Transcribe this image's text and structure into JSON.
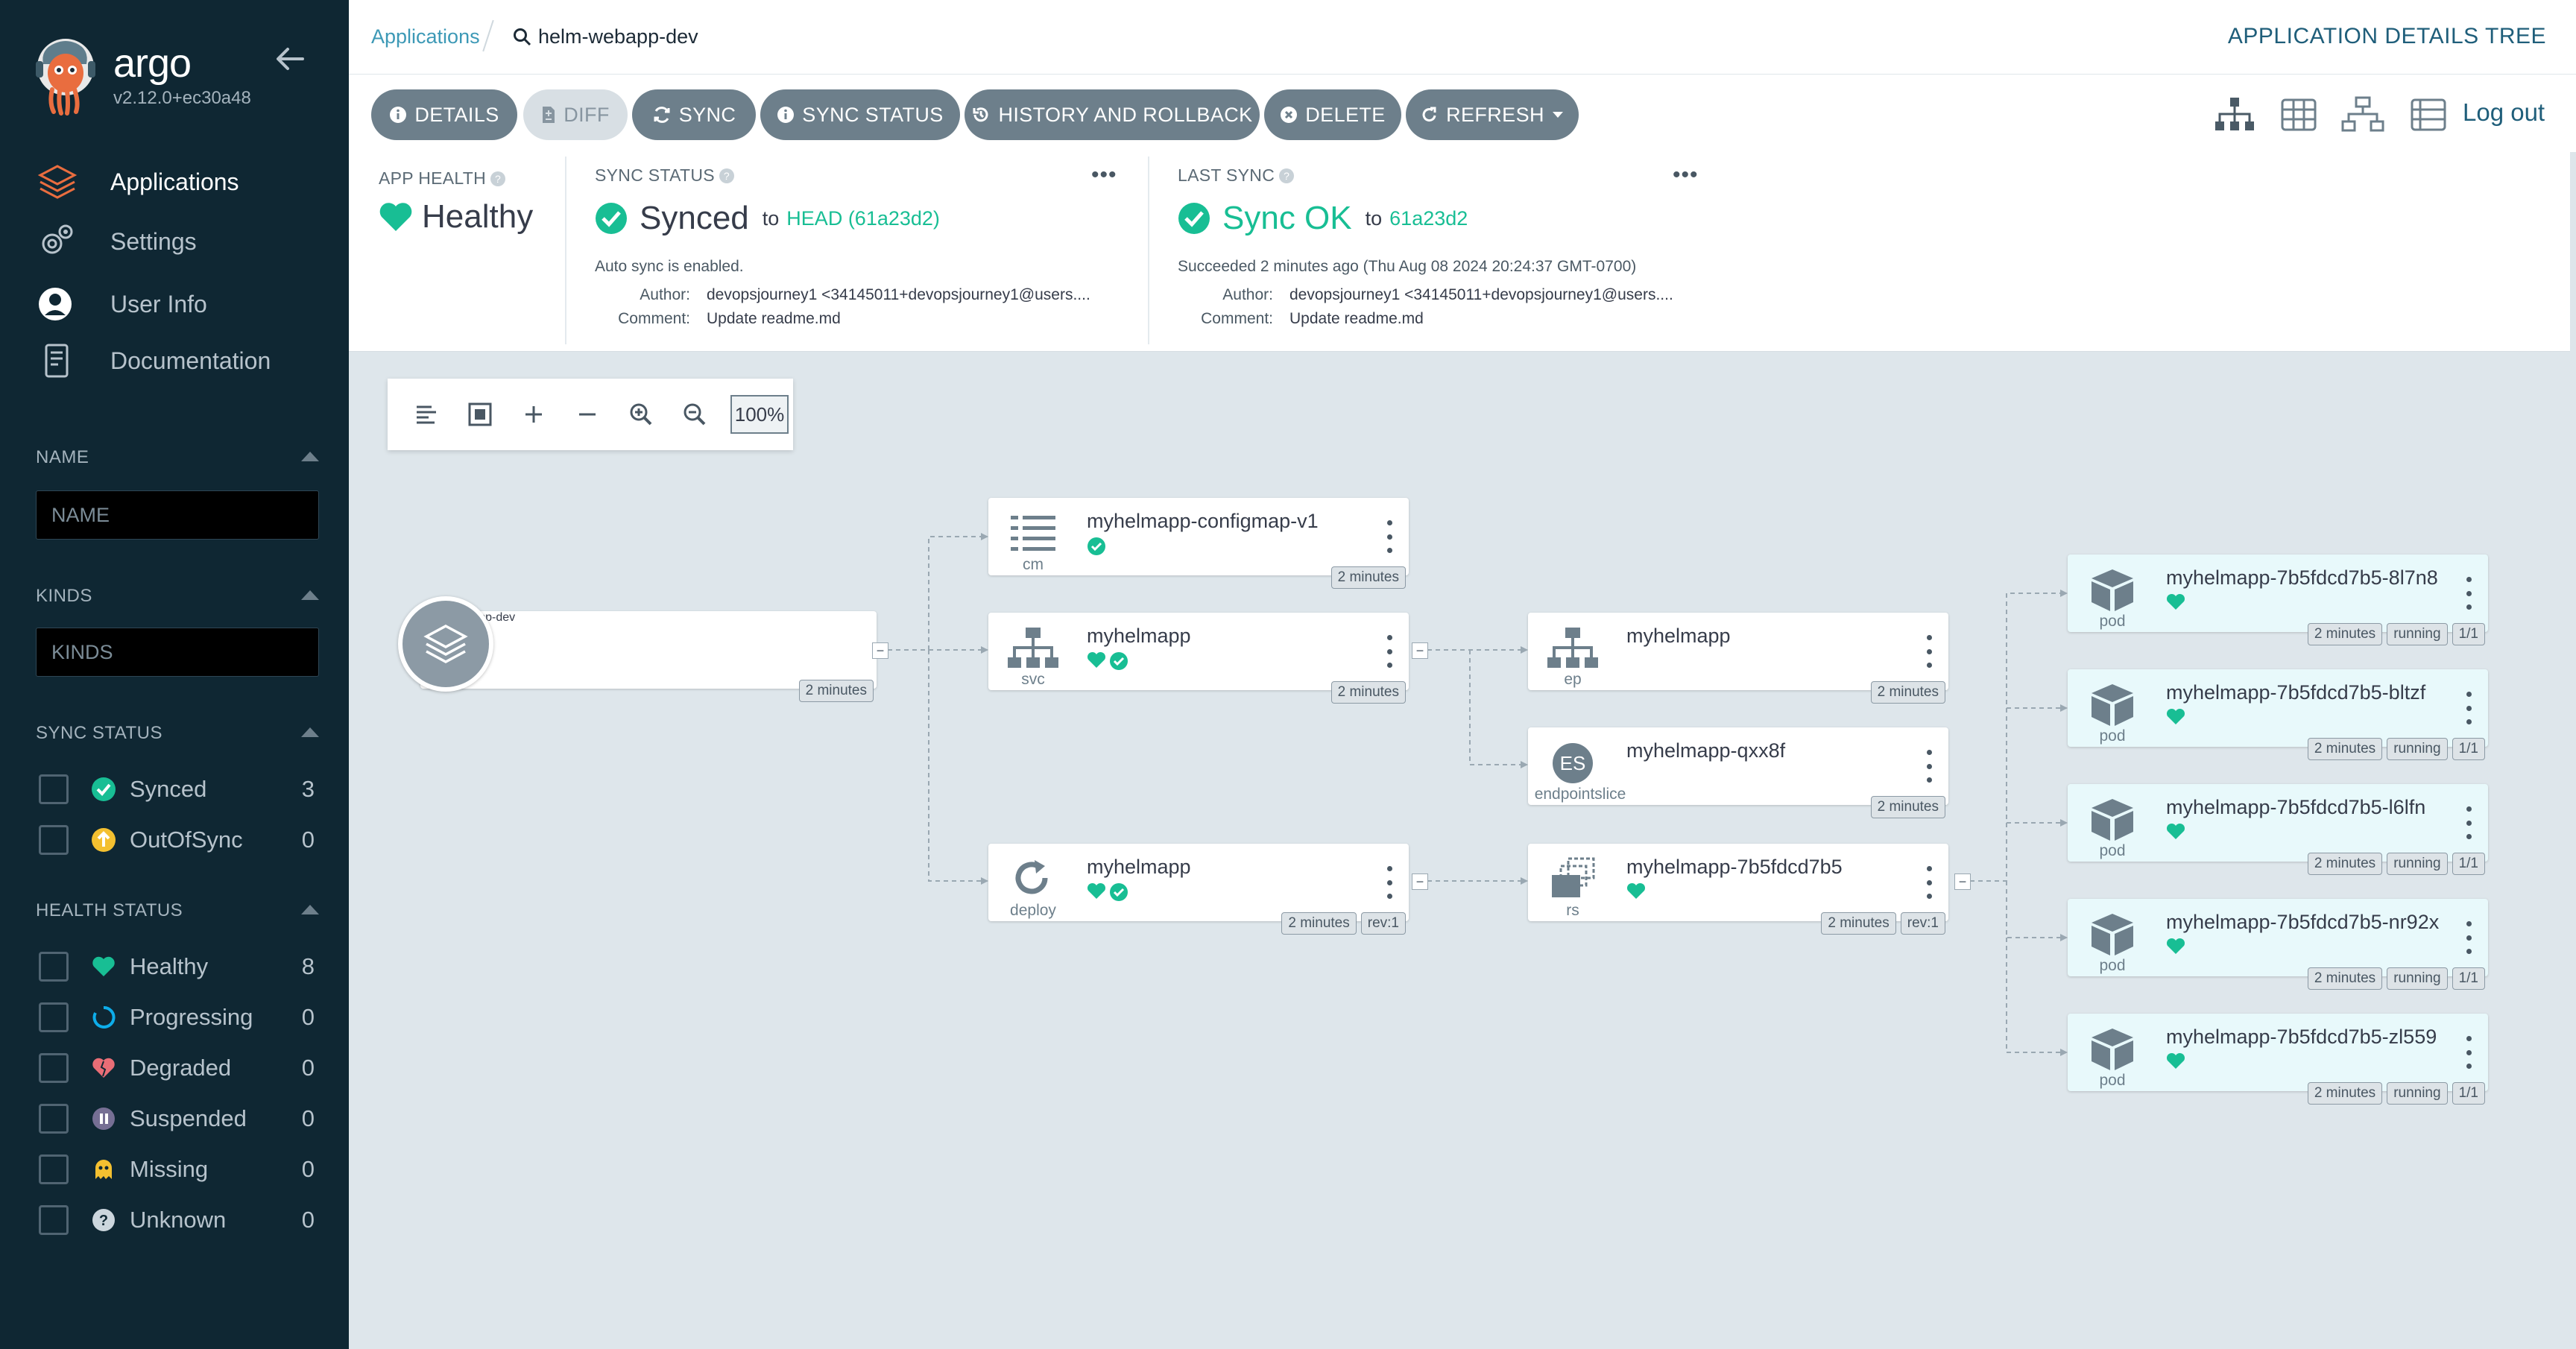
{
  "brand": {
    "name": "argo",
    "version": "v2.12.0+ec30a48"
  },
  "nav": [
    {
      "label": "Applications",
      "icon": "layers-icon",
      "active": true
    },
    {
      "label": "Settings",
      "icon": "gears-icon"
    },
    {
      "label": "User Info",
      "icon": "user-circle-icon"
    },
    {
      "label": "Documentation",
      "icon": "book-icon"
    }
  ],
  "filters": {
    "name": {
      "title": "NAME",
      "placeholder": "NAME"
    },
    "kinds": {
      "title": "KINDS",
      "placeholder": "KINDS"
    },
    "sync_status": {
      "title": "SYNC STATUS",
      "items": [
        {
          "label": "Synced",
          "count": "3",
          "icon": "check-circle-icon",
          "color": "#18be94"
        },
        {
          "label": "OutOfSync",
          "count": "0",
          "icon": "arrow-up-circle-icon",
          "color": "#f4c030"
        }
      ]
    },
    "health_status": {
      "title": "HEALTH STATUS",
      "items": [
        {
          "label": "Healthy",
          "count": "8",
          "icon": "heart-icon",
          "color": "#18be94"
        },
        {
          "label": "Progressing",
          "count": "0",
          "icon": "circle-notch-icon",
          "color": "#0dadea"
        },
        {
          "label": "Degraded",
          "count": "0",
          "icon": "heart-broken-icon",
          "color": "#e96d76"
        },
        {
          "label": "Suspended",
          "count": "0",
          "icon": "pause-circle-icon",
          "color": "#766f94"
        },
        {
          "label": "Missing",
          "count": "0",
          "icon": "ghost-icon",
          "color": "#f4c030"
        },
        {
          "label": "Unknown",
          "count": "0",
          "icon": "question-circle-icon",
          "color": "#ccd6dd"
        }
      ]
    }
  },
  "breadcrumb": {
    "root": "Applications",
    "current": "helm-webapp-dev"
  },
  "page_title": "APPLICATION DETAILS TREE",
  "toolbar": {
    "details": "DETAILS",
    "diff": "DIFF",
    "sync": "SYNC",
    "sync_status": "SYNC STATUS",
    "history": "HISTORY AND ROLLBACK",
    "delete": "DELETE",
    "refresh": "REFRESH",
    "logout": "Log out"
  },
  "status": {
    "app_health": {
      "title": "APP HEALTH",
      "value": "Healthy"
    },
    "sync_status": {
      "title": "SYNC STATUS",
      "value": "Synced",
      "to": "to",
      "revision": "HEAD (61a23d2)",
      "auto_sync": "Auto sync is enabled.",
      "author_label": "Author:",
      "author": "devopsjourney1 <34145011+devopsjourney1@users....",
      "comment_label": "Comment:",
      "comment": "Update readme.md"
    },
    "last_sync": {
      "title": "LAST SYNC",
      "value": "Sync OK",
      "to": "to",
      "revision": "61a23d2",
      "succeeded": "Succeeded 2 minutes ago (Thu Aug 08 2024 20:24:37 GMT-0700)",
      "author_label": "Author:",
      "author": "devopsjourney1 <34145011+devopsjourney1@users....",
      "comment_label": "Comment:",
      "comment": "Update readme.md"
    }
  },
  "zoom": {
    "level": "100%"
  },
  "tree": {
    "app": {
      "name": "helm-webapp-dev",
      "age": "2 minutes"
    },
    "configmap": {
      "name": "myhelmapp-configmap-v1",
      "kind": "cm",
      "age": "2 minutes"
    },
    "svc": {
      "name": "myhelmapp",
      "kind": "svc",
      "age": "2 minutes"
    },
    "deploy": {
      "name": "myhelmapp",
      "kind": "deploy",
      "age": "2 minutes",
      "rev": "rev:1"
    },
    "ep": {
      "name": "myhelmapp",
      "kind": "ep",
      "age": "2 minutes"
    },
    "endpointslice": {
      "name": "myhelmapp-qxx8f",
      "kind": "endpointslice",
      "icon_text": "ES",
      "age": "2 minutes"
    },
    "rs": {
      "name": "myhelmapp-7b5fdcd7b5",
      "kind": "rs",
      "age": "2 minutes",
      "rev": "rev:1"
    },
    "pods": [
      {
        "name": "myhelmapp-7b5fdcd7b5-8l7n8",
        "kind": "pod",
        "age": "2 minutes",
        "state": "running",
        "ready": "1/1"
      },
      {
        "name": "myhelmapp-7b5fdcd7b5-bltzf",
        "kind": "pod",
        "age": "2 minutes",
        "state": "running",
        "ready": "1/1"
      },
      {
        "name": "myhelmapp-7b5fdcd7b5-l6lfn",
        "kind": "pod",
        "age": "2 minutes",
        "state": "running",
        "ready": "1/1"
      },
      {
        "name": "myhelmapp-7b5fdcd7b5-nr92x",
        "kind": "pod",
        "age": "2 minutes",
        "state": "running",
        "ready": "1/1"
      },
      {
        "name": "myhelmapp-7b5fdcd7b5-zl559",
        "kind": "pod",
        "age": "2 minutes",
        "state": "running",
        "ready": "1/1"
      }
    ]
  },
  "colors": {
    "sidebar": "#0f2733",
    "healthy": "#18be94",
    "link": "#3d99b6",
    "button": "#6d7f8b"
  }
}
